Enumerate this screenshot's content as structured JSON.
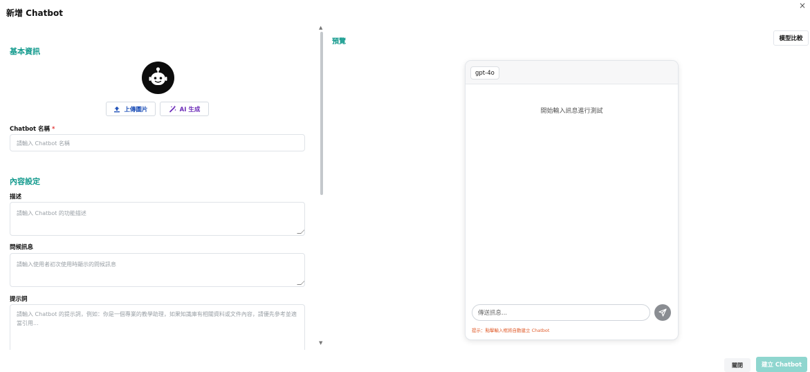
{
  "dialog": {
    "title": "新增 Chatbot",
    "close_glyph": "×"
  },
  "basic": {
    "section_title": "基本資訊",
    "avatar_icon": "robot-icon",
    "upload_label": "上傳圖片",
    "ai_label": "AI 生成",
    "name_label": "Chatbot 名稱",
    "required_mark": "*",
    "name_placeholder": "請輸入 Chatbot 名稱"
  },
  "content": {
    "section_title": "內容設定",
    "description_label": "描述",
    "description_placeholder": "請輸入 Chatbot 的功能描述",
    "greeting_label": "問候訊息",
    "greeting_placeholder": "請輸入使用者初次使用時顯示的問候訊息",
    "prompt_label": "提示詞",
    "prompt_placeholder": "請輸入 Chatbot 的提示詞，例如：你是一個專業的教學助理，如果知識庫有相關資料或文件內容，請優先參考並適當引用..."
  },
  "preview": {
    "label": "預覽",
    "compare_button": "模型比較",
    "model_chip": "gpt-4o",
    "empty_message": "開始輸入訊息進行測試",
    "input_placeholder": "傳送訊息...",
    "hint": "提示：點擊輸入框將自動建立 Chatbot"
  },
  "footer": {
    "close_label": "關閉",
    "create_label": "建立 Chatbot"
  },
  "colors": {
    "accent": "#129a8d",
    "create_button": "#8fd6cf",
    "hint": "#e05b2a",
    "required": "#e23b3b"
  }
}
